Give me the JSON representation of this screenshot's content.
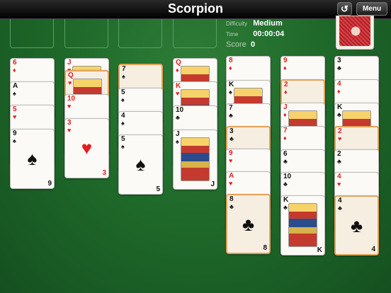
{
  "header": {
    "title": "Scorpion",
    "undo_icon": "undo-icon",
    "menu_label": "Menu"
  },
  "info": {
    "difficulty_label": "Difficulty",
    "difficulty_value": "Medium",
    "time_label": "Time",
    "time_value": "00:00:04",
    "score_label": "Score",
    "score_value": "0"
  },
  "colors": {
    "felt": "#1f6a2a",
    "highlight": "#e1a35a",
    "red_suit": "#e02020",
    "card_back": "#c0282d"
  },
  "columns": [
    {
      "cards": [
        {
          "rank": "6",
          "suit": "♦",
          "color": "red"
        },
        {
          "rank": "A",
          "suit": "♠",
          "color": "black"
        },
        {
          "rank": "5",
          "suit": "♥",
          "color": "red"
        },
        {
          "rank": "9",
          "suit": "♠",
          "color": "black"
        }
      ]
    },
    {
      "cards": [
        {
          "rank": "J",
          "suit": "♥",
          "color": "red",
          "face": true
        },
        {
          "rank": "Q",
          "suit": "♥",
          "color": "red",
          "face": true,
          "highlight": true
        },
        {
          "rank": "10",
          "suit": "♥",
          "color": "red"
        },
        {
          "rank": "3",
          "suit": "♥",
          "color": "red"
        }
      ]
    },
    {
      "cards": [
        {
          "rank": "7",
          "suit": "♠",
          "color": "black",
          "highlight": true
        },
        {
          "rank": "5",
          "suit": "♠",
          "color": "black"
        },
        {
          "rank": "4",
          "suit": "♠",
          "color": "black"
        },
        {
          "rank": "5",
          "suit": "♠",
          "color": "black"
        }
      ]
    },
    {
      "cards": [
        {
          "rank": "Q",
          "suit": "♦",
          "color": "red",
          "face": true
        },
        {
          "rank": "K",
          "suit": "♥",
          "color": "red",
          "face": true
        },
        {
          "rank": "10",
          "suit": "♣",
          "color": "black"
        },
        {
          "rank": "J",
          "suit": "♠",
          "color": "black",
          "face": true
        }
      ]
    },
    {
      "cards": [
        {
          "rank": "8",
          "suit": "♦",
          "color": "red"
        },
        {
          "rank": "K",
          "suit": "♠",
          "color": "black",
          "face": true
        },
        {
          "rank": "7",
          "suit": "♣",
          "color": "black"
        },
        {
          "rank": "3",
          "suit": "♣",
          "color": "black",
          "highlight": true
        },
        {
          "rank": "9",
          "suit": "♥",
          "color": "red"
        },
        {
          "rank": "A",
          "suit": "♥",
          "color": "red"
        },
        {
          "rank": "8",
          "suit": "♣",
          "color": "black",
          "highlight": true
        }
      ]
    },
    {
      "cards": [
        {
          "rank": "9",
          "suit": "♦",
          "color": "red"
        },
        {
          "rank": "2",
          "suit": "♦",
          "color": "red",
          "highlight": true
        },
        {
          "rank": "J",
          "suit": "♦",
          "color": "red",
          "face": true
        },
        {
          "rank": "7",
          "suit": "♦",
          "color": "red"
        },
        {
          "rank": "6",
          "suit": "♣",
          "color": "black"
        },
        {
          "rank": "10",
          "suit": "♣",
          "color": "black"
        },
        {
          "rank": "K",
          "suit": "♣",
          "color": "black",
          "face": true
        }
      ]
    },
    {
      "cards": [
        {
          "rank": "3",
          "suit": "♣",
          "color": "black"
        },
        {
          "rank": "4",
          "suit": "♦",
          "color": "red"
        },
        {
          "rank": "K",
          "suit": "♣",
          "color": "black",
          "face": true
        },
        {
          "rank": "2",
          "suit": "♥",
          "color": "red",
          "highlight": true
        },
        {
          "rank": "2",
          "suit": "♣",
          "color": "black"
        },
        {
          "rank": "4",
          "suit": "♥",
          "color": "red"
        },
        {
          "rank": "4",
          "suit": "♣",
          "color": "black",
          "highlight": true
        }
      ]
    }
  ]
}
